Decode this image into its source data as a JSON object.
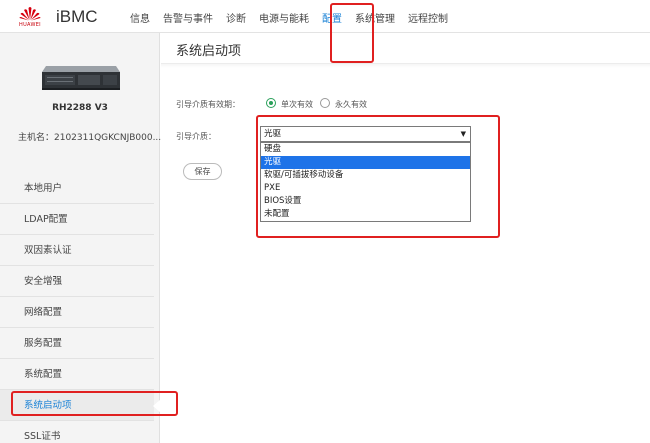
{
  "header": {
    "logo_text": "HUAWEI",
    "brand": "iBMC",
    "nav": [
      {
        "label": "信息"
      },
      {
        "label": "告警与事件"
      },
      {
        "label": "诊断"
      },
      {
        "label": "电源与能耗"
      },
      {
        "label": "配置",
        "active": true
      },
      {
        "label": "系统管理"
      },
      {
        "label": "远程控制"
      }
    ]
  },
  "sidebar": {
    "model": "RH2288 V3",
    "hostname": "主机名：2102311QGKCNJB000...",
    "items": [
      {
        "label": "本地用户"
      },
      {
        "label": "LDAP配置"
      },
      {
        "label": "双因素认证"
      },
      {
        "label": "安全增强"
      },
      {
        "label": "网络配置"
      },
      {
        "label": "服务配置"
      },
      {
        "label": "系统配置"
      },
      {
        "label": "系统启动项",
        "active": true
      },
      {
        "label": "SSL证书"
      }
    ]
  },
  "main": {
    "title": "系统启动项",
    "validity_label": "引导介质有效期：",
    "validity_options": [
      "单次有效",
      "永久有效"
    ],
    "validity_selected": "单次有效",
    "media_label": "引导介质：",
    "media_value": "光驱",
    "media_options": [
      "硬盘",
      "光驱",
      "软驱/可插拔移动设备",
      "PXE",
      "BIOS设置",
      "未配置"
    ],
    "media_highlighted": "光驱",
    "save_label": "保存"
  },
  "colors": {
    "accent": "#1a82d6",
    "annotation": "#e02020",
    "radio_checked": "#2aa05a",
    "option_highlight": "#1e73e8"
  }
}
